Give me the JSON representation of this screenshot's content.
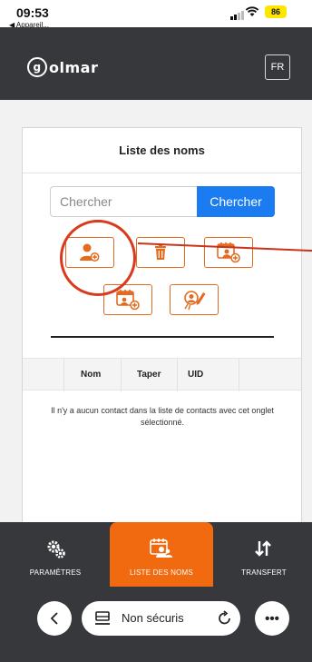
{
  "status_bar": {
    "time": "09:53",
    "back_app": "◀ Appareil...",
    "battery": "86"
  },
  "header": {
    "logo": "olmar",
    "logo_initial": "g",
    "language": "FR"
  },
  "contacts": {
    "title": "Liste des noms",
    "search": {
      "placeholder": "Chercher",
      "button_label": "Chercher"
    },
    "actions": [
      "add-contact",
      "delete",
      "add-to-list",
      "add-list",
      "edit-list"
    ],
    "table": {
      "columns": [
        "Nom",
        "Taper",
        "UID"
      ]
    },
    "empty_message": "Il n'y a aucun contact dans la liste de contacts avec cet onglet sélectionné."
  },
  "bottom_nav": {
    "items": [
      {
        "label": "PARAMÈTRES",
        "icon": "settings-gears-icon"
      },
      {
        "label": "LISTE DES NOMS",
        "icon": "contacts-list-icon",
        "active": true
      },
      {
        "label": "TRANSFERT",
        "icon": "transfer-arrows-icon"
      }
    ]
  },
  "browser_bar": {
    "url_text": "Non sécuris"
  },
  "colors": {
    "accent_orange": "#f26a10",
    "primary_blue": "#1a7cf0",
    "header_dark": "#36383b",
    "annotation_red": "#d9391c"
  }
}
